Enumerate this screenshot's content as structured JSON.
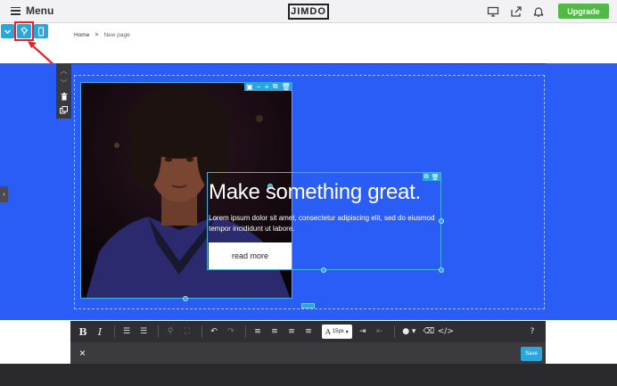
{
  "header": {
    "menu_label": "Menu",
    "logo_text": "JIMDO",
    "upgrade_label": "Upgrade",
    "icons": [
      "desktop-icon",
      "share-icon",
      "bell-icon"
    ]
  },
  "view_toolbar": {
    "icons": [
      "chevron-down-icon",
      "paint-bucket-icon",
      "mobile-icon"
    ],
    "highlighted": "paint-bucket-icon",
    "highlight_color": "#e5232a"
  },
  "breadcrumb": {
    "home": "Home",
    "separator": ">",
    "current": "New page"
  },
  "hero": {
    "background_color": "#2a5cf6",
    "headline": "Make something great.",
    "body": "Lorem ipsum dolor sit amet, consectetur adipiscing elit, sed do eiusmod tempor incididunt ut labore.",
    "button_label": "read more"
  },
  "editor_toolbar": {
    "font_size": "15px",
    "help": "?",
    "tools": [
      "bold-icon",
      "italic-icon",
      "ordered-list-icon",
      "unordered-list-icon",
      "link-icon",
      "unlink-icon",
      "undo-icon",
      "redo-icon",
      "align-left-icon",
      "align-center-icon",
      "align-right-icon",
      "align-justify-icon",
      "font-size-icon",
      "indent-icon",
      "outdent-icon",
      "color-icon",
      "eraser-icon",
      "code-icon"
    ]
  },
  "bottom_bar": {
    "close": "×",
    "save_label": "Save"
  },
  "colors": {
    "accent": "#2aa6db",
    "upgrade": "#54b848",
    "toolbar": "#2f2f33"
  }
}
